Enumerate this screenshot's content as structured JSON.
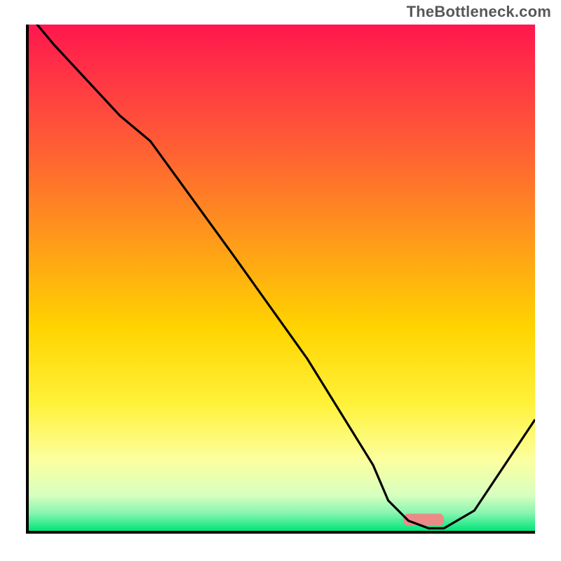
{
  "watermark": "TheBottleneck.com",
  "colors": {
    "axis": "#000000",
    "line": "#000000",
    "marker_fill": "#eb8b87",
    "gradient_stops": [
      {
        "offset": 0.0,
        "color": "#ff174d"
      },
      {
        "offset": 0.12,
        "color": "#ff3a43"
      },
      {
        "offset": 0.28,
        "color": "#ff6a2f"
      },
      {
        "offset": 0.45,
        "color": "#ffa216"
      },
      {
        "offset": 0.6,
        "color": "#ffd400"
      },
      {
        "offset": 0.75,
        "color": "#fff23a"
      },
      {
        "offset": 0.86,
        "color": "#fcffa0"
      },
      {
        "offset": 0.93,
        "color": "#d7ffbf"
      },
      {
        "offset": 0.965,
        "color": "#88f5b0"
      },
      {
        "offset": 1.0,
        "color": "#00e57a"
      }
    ]
  },
  "chart_data": {
    "type": "line",
    "title": "",
    "xlabel": "",
    "ylabel": "",
    "xlim": [
      0,
      100
    ],
    "ylim": [
      0,
      100
    ],
    "x": [
      0,
      5,
      18,
      24,
      40,
      55,
      68,
      71,
      75,
      79,
      82,
      88,
      100
    ],
    "values": [
      102,
      96,
      82,
      77,
      55,
      34,
      13,
      6,
      2,
      0.5,
      0.5,
      4,
      22
    ],
    "flat_region": {
      "x_start": 75,
      "x_end": 82,
      "y": 0.5
    },
    "marker": {
      "x_start": 74,
      "x_end": 82,
      "y": 1.0,
      "height": 2.4
    }
  }
}
